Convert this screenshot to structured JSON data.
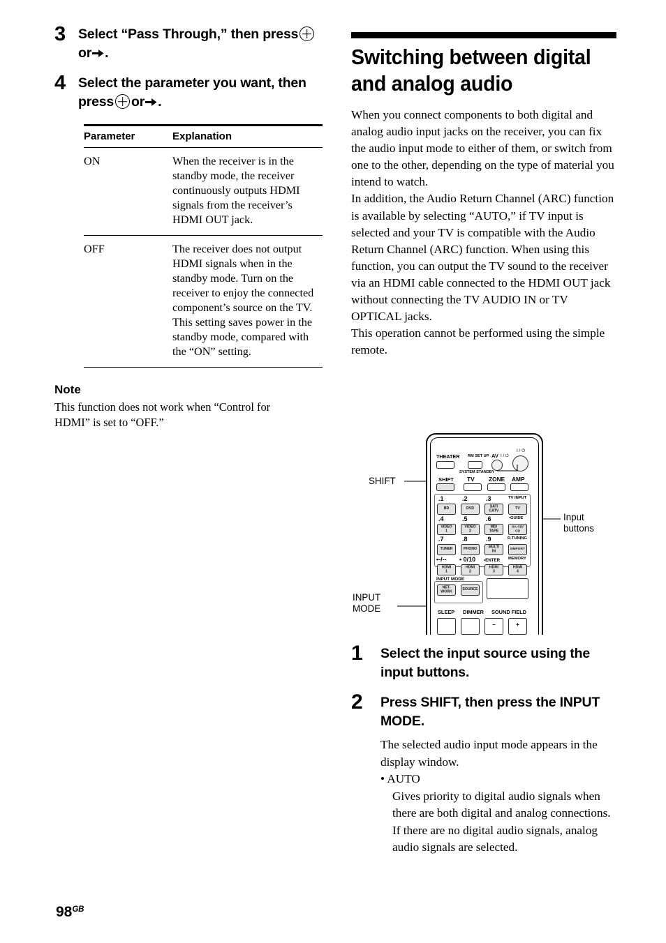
{
  "page": {
    "number": "98",
    "region_suffix": "GB"
  },
  "left_column": {
    "steps": [
      {
        "number": "3",
        "text_before": "Select “Pass Through,” then press",
        "text_middle": "or",
        "text_after": "."
      },
      {
        "number": "4",
        "text_before": "Select the parameter you want, then press",
        "text_middle": "or",
        "text_after": "."
      }
    ],
    "table": {
      "headers": [
        "Parameter",
        "Explanation"
      ],
      "rows": [
        {
          "parameter": "ON",
          "explanation": "When the receiver is in the standby mode, the receiver continuously outputs HDMI signals from the receiver’s HDMI OUT jack."
        },
        {
          "parameter": "OFF",
          "explanation": "The receiver does not output HDMI signals when in the standby mode. Turn on the receiver to enjoy the connected component’s source on the TV. This setting saves power in the standby mode, compared with the “ON” setting."
        }
      ]
    },
    "note": {
      "heading": "Note",
      "body": "This function does not work when “Control for HDMI” is set to “OFF.”"
    }
  },
  "right_column": {
    "section_title": "Switching between digital and analog audio",
    "paragraphs": [
      "When you connect components to both digital and analog audio input jacks on the receiver, you can fix the audio input mode to either of them, or switch from one to the other, depending on the type of material you intend to watch.",
      "In addition, the Audio Return Channel (ARC) function is available by selecting “AUTO,” if TV input is selected and your TV is compatible with the Audio Return Channel (ARC) function. When using this function, you can output the TV sound to the receiver via an HDMI cable connected to the HDMI OUT jack without connecting the TV AUDIO IN or TV OPTICAL jacks.",
      "This operation cannot be performed using the simple remote."
    ],
    "steps": [
      {
        "number": "1",
        "text": "Select the input source using the input buttons."
      },
      {
        "number": "2",
        "text": "Press SHIFT, then press the INPUT MODE.",
        "details": [
          "The selected audio input mode appears in the display window.",
          "• AUTO",
          "Gives priority to digital audio signals when there are both digital and analog connections.",
          "If there are no digital audio signals, analog audio signals are selected."
        ]
      }
    ]
  },
  "figure": {
    "callouts": [
      {
        "id": "shift",
        "label": "SHIFT"
      },
      {
        "id": "input-buttons",
        "label": "Input\nbuttons"
      },
      {
        "id": "input-mode",
        "label": "INPUT\nMODE"
      }
    ],
    "remote": {
      "top_row_labels": [
        "THEATER",
        "RM SET UP",
        "AV",
        "SYSTEM STANDBY"
      ],
      "power_symbols": [
        "I / ⏻",
        "I / ⏻"
      ],
      "mode_row": [
        "SHIFT",
        "TV",
        "ZONE",
        "AMP"
      ],
      "input_grid": [
        {
          "num": ".1",
          "btn": "BD",
          "alt": ""
        },
        {
          "num": ".2",
          "btn": "DVD",
          "alt": ""
        },
        {
          "num": ".3",
          "btn": "SAT/\nCATV",
          "alt": ""
        },
        {
          "num": "",
          "btn": "TV",
          "alt": "TV INPUT"
        },
        {
          "num": ".4",
          "btn": "VIDEO\n1",
          "alt": ""
        },
        {
          "num": ".5",
          "btn": "VIDEO\n2",
          "alt": ""
        },
        {
          "num": ".6",
          "btn": "MD/\nTAPE",
          "alt": ""
        },
        {
          "num": "",
          "btn": "SA-CD/\nCD",
          "alt": "•GUIDE"
        },
        {
          "num": ".7",
          "btn": "TUNER",
          "alt": ""
        },
        {
          "num": ".8",
          "btn": "PHONO",
          "alt": ""
        },
        {
          "num": ".9",
          "btn": "MULTI\nIN",
          "alt": ""
        },
        {
          "num": "",
          "btn": "DMPORT",
          "alt": "D.TUNING"
        },
        {
          "num": "•-/--",
          "btn": "HDMI\n1",
          "alt": ""
        },
        {
          "num": "• 0/10",
          "btn": "HDMI\n2",
          "alt": ""
        },
        {
          "num": "•ENTER",
          "btn": "HDMI\n3",
          "alt": ""
        },
        {
          "num": "",
          "btn": "HDMI\n4",
          "alt": "MEMORY"
        }
      ],
      "input_mode_label": "INPUT MODE",
      "input_mode_buttons": [
        "NET-\nWORK",
        "SOURCE"
      ],
      "bottom_labels": [
        "SLEEP",
        "DIMMER",
        "SOUND FIELD"
      ],
      "bottom_buttons": [
        "–",
        "+"
      ]
    }
  }
}
